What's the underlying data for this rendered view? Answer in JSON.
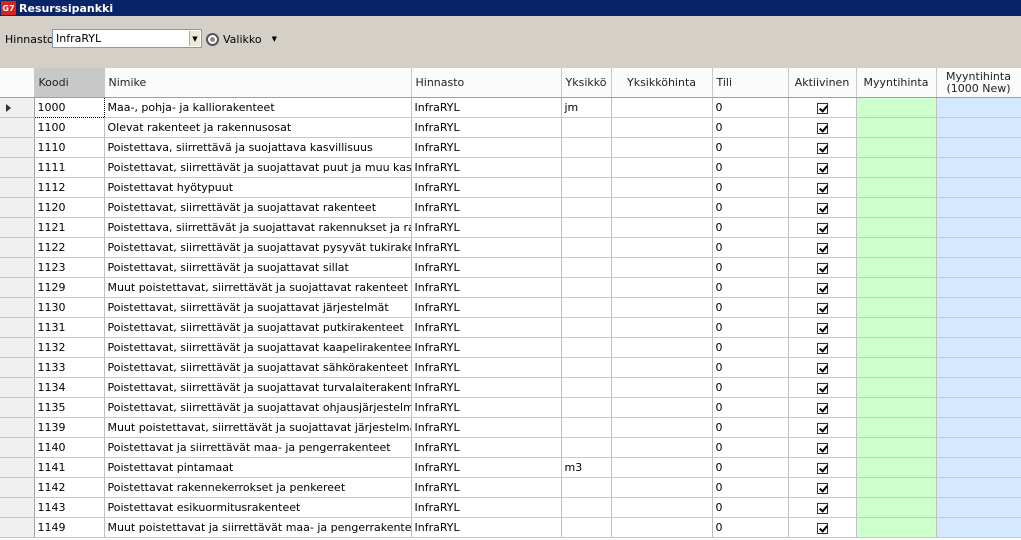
{
  "window": {
    "logo_text": "G7",
    "title": "Resurssipankki"
  },
  "toolbar": {
    "hinnasto_label": "Hinnasto",
    "hinnasto_value": "InfraRYL",
    "menu_label": "Valikko"
  },
  "columns": [
    "Koodi",
    "Nimike",
    "Hinnasto",
    "Yksikkö",
    "Yksikköhinta",
    "Tili",
    "Aktiivinen",
    "Myyntihinta",
    "Myyntihinta (1000 New)"
  ],
  "rows": [
    {
      "code": "1000",
      "name": "Maa-, pohja- ja kalliorakenteet",
      "list": "InfraRYL",
      "unit": "jm",
      "price": "",
      "account": "0",
      "active": true
    },
    {
      "code": "1100",
      "name": "Olevat rakenteet ja rakennusosat",
      "list": "InfraRYL",
      "unit": "",
      "price": "",
      "account": "0",
      "active": true
    },
    {
      "code": "1110",
      "name": "Poistettava, siirrettävä ja suojattava kasvillisuus",
      "list": "InfraRYL",
      "unit": "",
      "price": "",
      "account": "0",
      "active": true
    },
    {
      "code": "1111",
      "name": "Poistettavat, siirrettävät ja suojattavat puut ja muu kasvil",
      "list": "InfraRYL",
      "unit": "",
      "price": "",
      "account": "0",
      "active": true
    },
    {
      "code": "1112",
      "name": "Poistettavat hyötypuut",
      "list": "InfraRYL",
      "unit": "",
      "price": "",
      "account": "0",
      "active": true
    },
    {
      "code": "1120",
      "name": "Poistettavat, siirrettävät ja suojattavat rakenteet",
      "list": "InfraRYL",
      "unit": "",
      "price": "",
      "account": "0",
      "active": true
    },
    {
      "code": "1121",
      "name": "Poistettava, siirrettävät ja suojattavat rakennukset ja rak",
      "list": "InfraRYL",
      "unit": "",
      "price": "",
      "account": "0",
      "active": true
    },
    {
      "code": "1122",
      "name": "Poistettavat, siirrettävät ja suojattavat pysyvät tukirakent",
      "list": "InfraRYL",
      "unit": "",
      "price": "",
      "account": "0",
      "active": true
    },
    {
      "code": "1123",
      "name": "Poistettavat, siirrettävät ja suojattavat sillat",
      "list": "InfraRYL",
      "unit": "",
      "price": "",
      "account": "0",
      "active": true
    },
    {
      "code": "1129",
      "name": "Muut poistettavat, siirrettävät ja suojattavat rakenteet",
      "list": "InfraRYL",
      "unit": "",
      "price": "",
      "account": "0",
      "active": true
    },
    {
      "code": "1130",
      "name": "Poistettavat, siirrettävät ja suojattavat järjestelmät",
      "list": "InfraRYL",
      "unit": "",
      "price": "",
      "account": "0",
      "active": true
    },
    {
      "code": "1131",
      "name": "Poistettavat, siirrettävät ja suojattavat putkirakenteet",
      "list": "InfraRYL",
      "unit": "",
      "price": "",
      "account": "0",
      "active": true
    },
    {
      "code": "1132",
      "name": "Poistettavat, siirrettävät ja suojattavat kaapelirakenteet",
      "list": "InfraRYL",
      "unit": "",
      "price": "",
      "account": "0",
      "active": true
    },
    {
      "code": "1133",
      "name": "Poistettavat, siirrettävät ja suojattavat sähkörakenteet",
      "list": "InfraRYL",
      "unit": "",
      "price": "",
      "account": "0",
      "active": true
    },
    {
      "code": "1134",
      "name": "Poistettavat, siirrettävät ja suojattavat turvalaiterakentee",
      "list": "InfraRYL",
      "unit": "",
      "price": "",
      "account": "0",
      "active": true
    },
    {
      "code": "1135",
      "name": "Poistettavat, siirrettävät ja suojattavat ohjausjärjestelmät",
      "list": "InfraRYL",
      "unit": "",
      "price": "",
      "account": "0",
      "active": true
    },
    {
      "code": "1139",
      "name": "Muut poistettavat, siirrettävät ja suojattavat järjestelmät",
      "list": "InfraRYL",
      "unit": "",
      "price": "",
      "account": "0",
      "active": true
    },
    {
      "code": "1140",
      "name": "Poistettavat ja siirrettävät maa- ja pengerrakenteet",
      "list": "InfraRYL",
      "unit": "",
      "price": "",
      "account": "0",
      "active": true
    },
    {
      "code": "1141",
      "name": "Poistettavat pintamaat",
      "list": "InfraRYL",
      "unit": "m3",
      "price": "",
      "account": "0",
      "active": true
    },
    {
      "code": "1142",
      "name": "Poistettavat rakennekerrokset ja penkereet",
      "list": "InfraRYL",
      "unit": "",
      "price": "",
      "account": "0",
      "active": true
    },
    {
      "code": "1143",
      "name": "Poistettavat esikuormitusrakenteet",
      "list": "InfraRYL",
      "unit": "",
      "price": "",
      "account": "0",
      "active": true
    },
    {
      "code": "1149",
      "name": "Muut poistettavat ja siirrettävät maa- ja pengerrakenteet",
      "list": "InfraRYL",
      "unit": "",
      "price": "",
      "account": "0",
      "active": true
    }
  ],
  "colors": {
    "titlebar": "#0a246a",
    "myyntihinta_bg": "#ccffcc",
    "myyntihinta_new_bg": "#d4e8ff"
  }
}
